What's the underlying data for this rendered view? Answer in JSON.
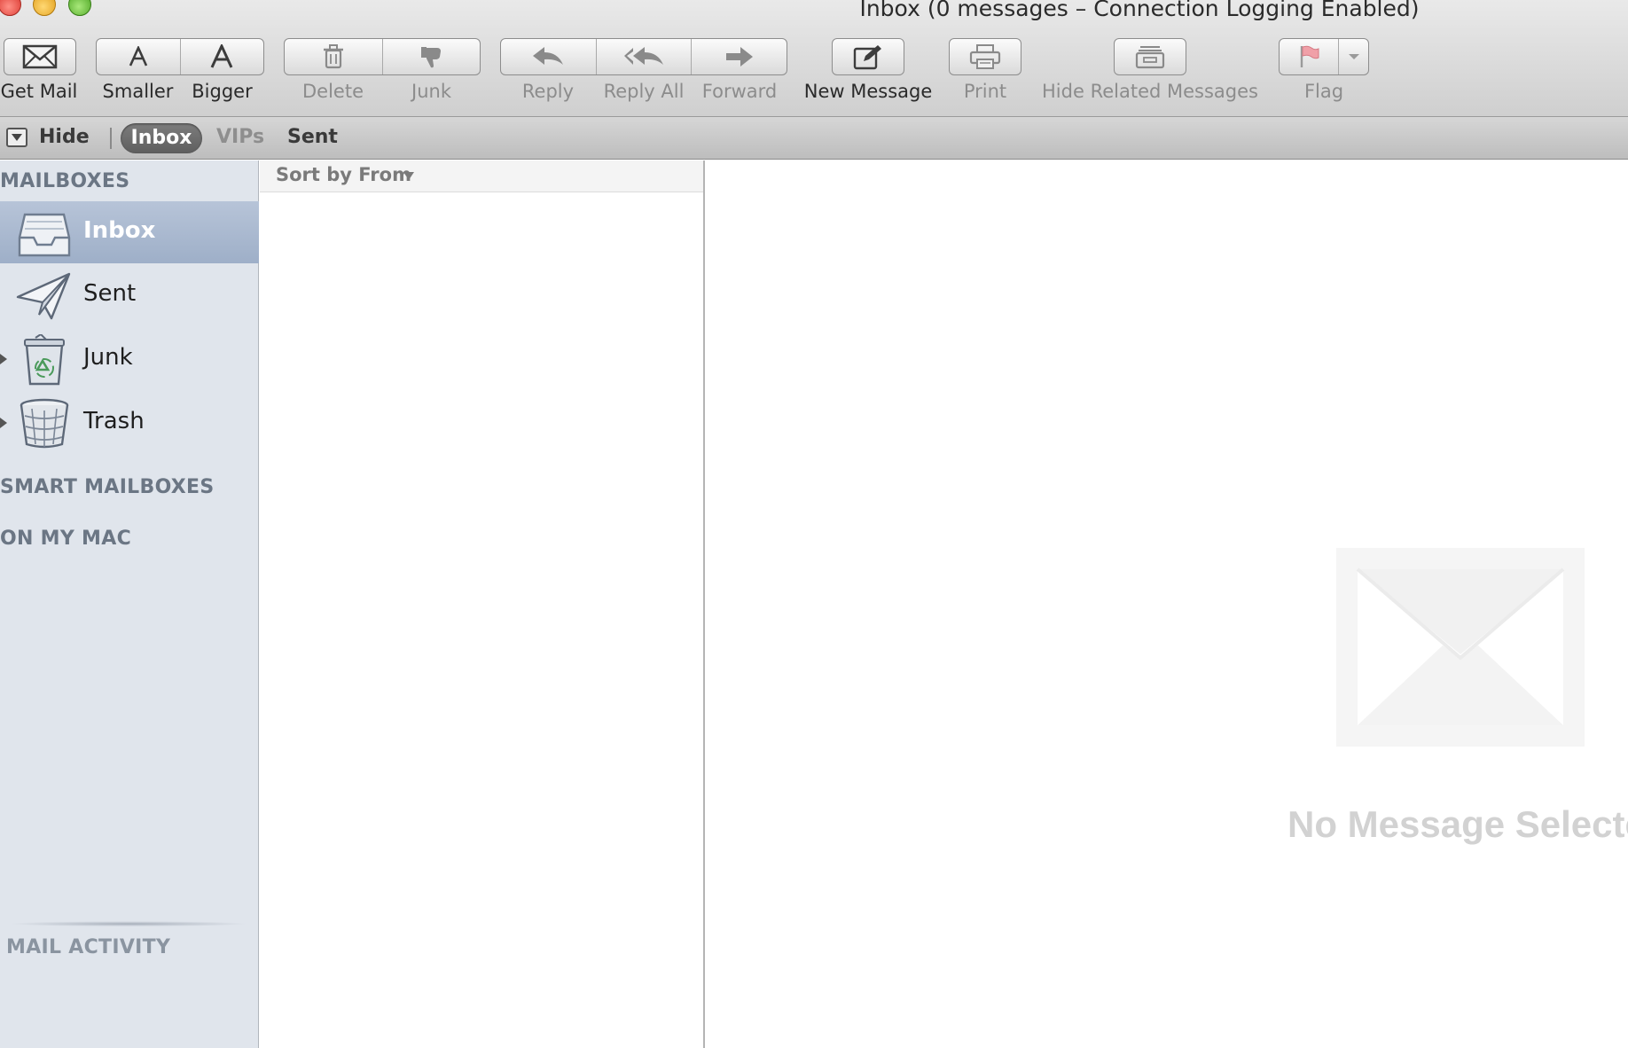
{
  "window": {
    "title": "Inbox (0 messages – Connection Logging Enabled)"
  },
  "toolbar": {
    "get_mail": "Get Mail",
    "smaller": "Smaller",
    "bigger": "Bigger",
    "delete": "Delete",
    "junk": "Junk",
    "reply": "Reply",
    "reply_all": "Reply All",
    "forward": "Forward",
    "new_message": "New Message",
    "print": "Print",
    "hide_related": "Hide Related Messages",
    "flag": "Flag"
  },
  "favorites": {
    "hide": "Hide",
    "inbox": "Inbox",
    "vips": "VIPs",
    "sent": "Sent"
  },
  "sidebar": {
    "mailboxes_heading": "MAILBOXES",
    "items": [
      {
        "label": "Inbox",
        "icon": "inbox-tray-icon"
      },
      {
        "label": "Sent",
        "icon": "paper-plane-icon"
      },
      {
        "label": "Junk",
        "icon": "junk-recycle-bin-icon"
      },
      {
        "label": "Trash",
        "icon": "trash-basket-icon"
      }
    ],
    "smart_mailboxes_heading": "SMART MAILBOXES",
    "on_my_mac_heading": "ON MY MAC",
    "mail_activity_heading": "MAIL ACTIVITY"
  },
  "message_list": {
    "sort_label": "Sort by From"
  },
  "preview": {
    "empty_text": "No Message Selected"
  },
  "colors": {
    "sidebar_bg": "#e0e5ec",
    "sidebar_selected": "#a8b8cf",
    "heading_text": "#6b7684"
  }
}
